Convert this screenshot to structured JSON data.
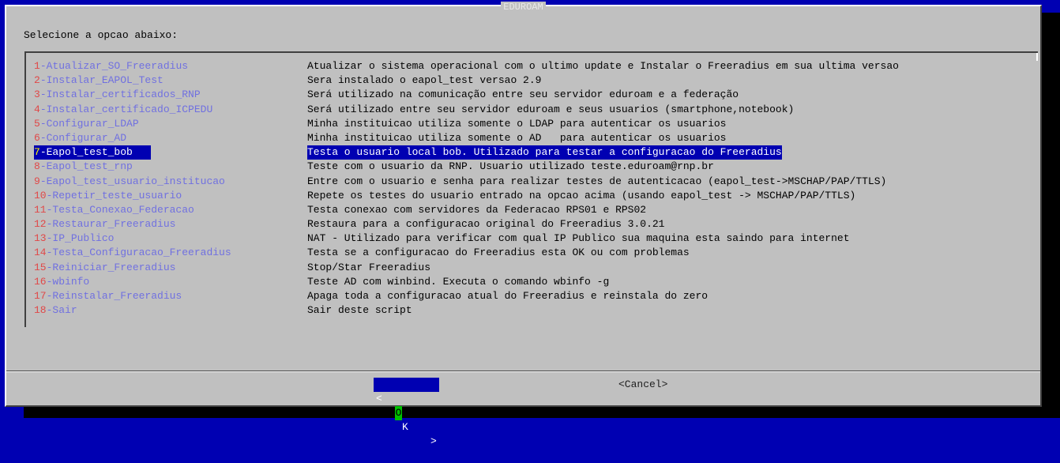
{
  "dialog": {
    "title": "EDUROAM",
    "prompt": "Selecione a opcao abaixo:"
  },
  "menu": {
    "selected_index": 6,
    "items": [
      {
        "num": "1",
        "label": "-Atualizar_SO_Freeradius",
        "desc": "Atualizar o sistema operacional com o ultimo update e Instalar o Freeradius em sua ultima versao"
      },
      {
        "num": "2",
        "label": "-Instalar_EAPOL_Test",
        "desc": "Sera instalado o eapol_test versao 2.9"
      },
      {
        "num": "3",
        "label": "-Instalar_certificados_RNP",
        "desc": "Será utilizado na comunicação entre seu servidor eduroam e a federação"
      },
      {
        "num": "4",
        "label": "-Instalar_certificado_ICPEDU",
        "desc": "Será utilizado entre seu servidor eduroam e seus usuarios (smartphone,notebook)"
      },
      {
        "num": "5",
        "label": "-Configurar_LDAP",
        "desc": "Minha instituicao utiliza somente o LDAP para autenticar os usuarios"
      },
      {
        "num": "6",
        "label": "-Configurar_AD",
        "desc": "Minha instituicao utiliza somente o AD   para autenticar os usuarios"
      },
      {
        "num": "7",
        "label": "-Eapol_test_bob",
        "desc": "Testa o usuario local bob. Utilizado para testar a configuracao do Freeradius"
      },
      {
        "num": "8",
        "label": "-Eapol_test_rnp",
        "desc": "Teste com o usuario da RNP. Usuario utilizado teste.eduroam@rnp.br"
      },
      {
        "num": "9",
        "label": "-Eapol_test_usuario_institucao",
        "desc": "Entre com o usuario e senha para realizar testes de autenticacao (eapol_test->MSCHAP/PAP/TTLS)"
      },
      {
        "num": "10",
        "label": "-Repetir_teste_usuario",
        "desc": "Repete os testes do usuario entrado na opcao acima (usando eapol_test -> MSCHAP/PAP/TTLS)"
      },
      {
        "num": "11",
        "label": "-Testa_Conexao_Federacao",
        "desc": "Testa conexao com servidores da Federacao RPS01 e RPS02"
      },
      {
        "num": "12",
        "label": "-Restaurar_Freeradius",
        "desc": "Restaura para a configuracao original do Freeradius 3.0.21"
      },
      {
        "num": "13",
        "label": "-IP_Publico",
        "desc": "NAT - Utilizado para verificar com qual IP Publico sua maquina esta saindo para internet"
      },
      {
        "num": "14",
        "label": "-Testa_Configuracao_Freeradius",
        "desc": "Testa se a configuracao do Freeradius esta OK ou com problemas"
      },
      {
        "num": "15",
        "label": "-Reiniciar_Freeradius",
        "desc": "Stop/Star Freeradius"
      },
      {
        "num": "16",
        "label": "-wbinfo",
        "desc": "Teste AD com winbind. Executa o comando wbinfo -g"
      },
      {
        "num": "17",
        "label": "-Reinstalar_Freeradius",
        "desc": "Apaga toda a configuracao atual do Freeradius e reinstala do zero"
      },
      {
        "num": "18",
        "label": "-Sair",
        "desc": "Sair deste script"
      }
    ]
  },
  "buttons": {
    "ok": {
      "left_bracket": "<",
      "hotkey": "O",
      "rest": "K",
      "right_bracket": ">"
    },
    "cancel": "<Cancel>"
  },
  "colors": {
    "screen_background": "#0000b2",
    "dialog_background": "#c0c0c0",
    "tag_text": "#7070e0",
    "tag_number": "#e04848",
    "selection_background": "#0000b2",
    "hotkey_background": "#00c000"
  }
}
